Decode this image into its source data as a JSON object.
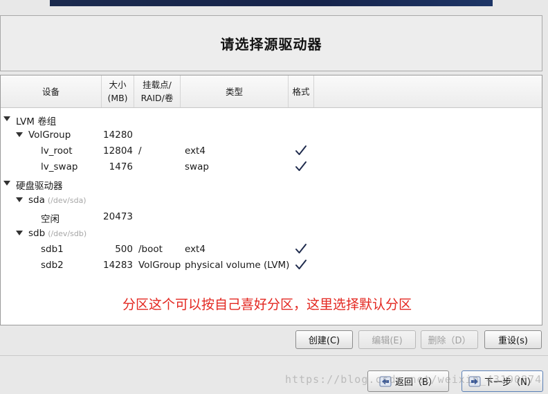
{
  "title": "请选择源驱动器",
  "columns": {
    "device": "设备",
    "size": "大小\n(MB)",
    "mount": "挂载点/\nRAID/卷",
    "type": "类型",
    "format": "格式"
  },
  "rows": [
    {
      "name": "LVM 卷组",
      "path": "",
      "size": "",
      "mount": "",
      "type": "",
      "format": false,
      "expander": true
    },
    {
      "name": "VolGroup",
      "path": "",
      "size": "14280",
      "mount": "",
      "type": "",
      "format": false,
      "expander": true
    },
    {
      "name": "lv_root",
      "path": "",
      "size": "12804",
      "mount": "/",
      "type": "ext4",
      "format": true,
      "expander": false
    },
    {
      "name": "lv_swap",
      "path": "",
      "size": "1476",
      "mount": "",
      "type": "swap",
      "format": true,
      "expander": false
    },
    {
      "name": "硬盘驱动器",
      "path": "",
      "size": "",
      "mount": "",
      "type": "",
      "format": false,
      "expander": true
    },
    {
      "name": "sda",
      "path": "(/dev/sda)",
      "size": "",
      "mount": "",
      "type": "",
      "format": false,
      "expander": true
    },
    {
      "name": "空闲",
      "path": "",
      "size": "20473",
      "mount": "",
      "type": "",
      "format": false,
      "expander": false
    },
    {
      "name": "sdb",
      "path": "(/dev/sdb)",
      "size": "",
      "mount": "",
      "type": "",
      "format": false,
      "expander": true
    },
    {
      "name": "sdb1",
      "path": "",
      "size": "500",
      "mount": "/boot",
      "type": "ext4",
      "format": true,
      "expander": false
    },
    {
      "name": "sdb2",
      "path": "",
      "size": "14283",
      "mount": "VolGroup",
      "type": "physical volume (LVM)",
      "format": true,
      "expander": false
    }
  ],
  "annotation": "分区这个可以按自己喜好分区，这里选择默认分区",
  "buttons": {
    "create": "创建(C)",
    "edit": "编辑(E)",
    "delete": "删除（D）",
    "reset": "重设(s)",
    "back": "返回（B）",
    "next": "下一步（N）"
  },
  "watermark": "https://blog.csdn.net/weixin_43190874",
  "colors": {
    "annotation": "#e3261f",
    "check": "#1f2b4d"
  }
}
